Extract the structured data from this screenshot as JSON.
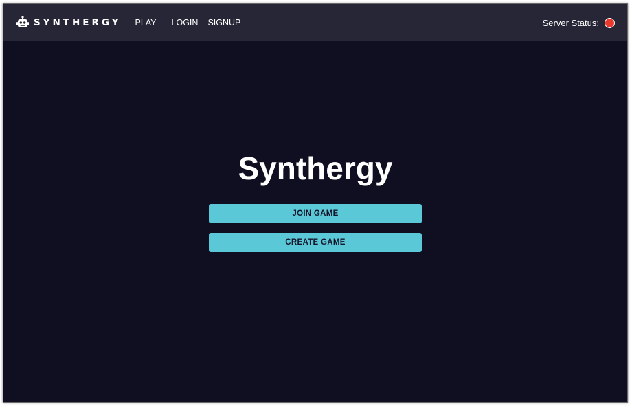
{
  "header": {
    "brand": "SYNTHERGY",
    "brand_icon": "robot-icon",
    "nav": {
      "play": "PLAY",
      "login": "LOGIN",
      "signup": "SIGNUP"
    },
    "server_status": {
      "label": "Server Status:",
      "state_color": "#e8392c"
    }
  },
  "main": {
    "title": "Synthergy",
    "buttons": {
      "join": "JOIN GAME",
      "create": "CREATE GAME"
    }
  },
  "colors": {
    "navbar_bg": "#262636",
    "page_bg": "#100f21",
    "accent": "#5bc8d8",
    "status_offline": "#e8392c"
  }
}
